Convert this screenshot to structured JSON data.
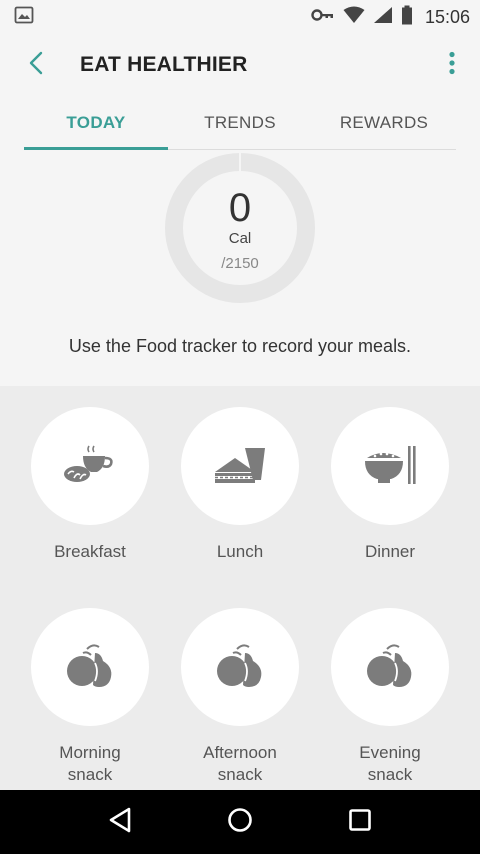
{
  "status_bar": {
    "time": "15:06",
    "icons": [
      "image-icon",
      "key-icon",
      "wifi-icon",
      "signal-icon",
      "battery-icon"
    ]
  },
  "app_bar": {
    "title": "EAT HEALTHIER",
    "back_icon": "chevron-left-icon",
    "menu_icon": "more-vertical-icon"
  },
  "tabs": [
    {
      "label": "TODAY",
      "active": true
    },
    {
      "label": "TRENDS",
      "active": false
    },
    {
      "label": "REWARDS",
      "active": false
    }
  ],
  "calories": {
    "value": "0",
    "unit": "Cal",
    "goal": "/2150",
    "progress": 0
  },
  "hint": "Use the Food tracker to record your meals.",
  "meals": [
    {
      "label": "Breakfast",
      "icon": "breakfast-icon"
    },
    {
      "label": "Lunch",
      "icon": "sandwich-icon"
    },
    {
      "label": "Dinner",
      "icon": "rice-bowl-icon"
    },
    {
      "label": "Morning\nsnack",
      "icon": "fruit-icon"
    },
    {
      "label": "Afternoon\nsnack",
      "icon": "fruit-icon"
    },
    {
      "label": "Evening\nsnack",
      "icon": "fruit-icon"
    }
  ],
  "colors": {
    "accent": "#3a9e96",
    "icon_gray": "#7c7c7c",
    "ring_track": "#e6e6e6"
  }
}
